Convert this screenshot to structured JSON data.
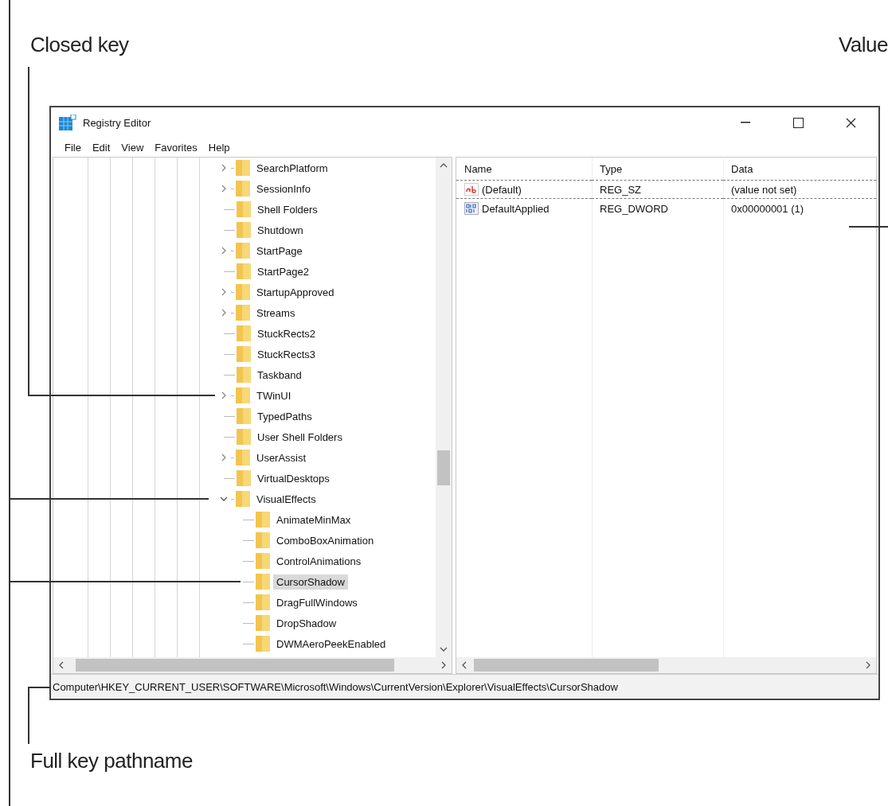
{
  "callouts": [
    {
      "text": "Closed key"
    },
    {
      "text": "Value"
    },
    {
      "text": "Full key pathname"
    }
  ],
  "window": {
    "title": "Registry Editor"
  },
  "menu": [
    "File",
    "Edit",
    "View",
    "Favorites",
    "Help"
  ],
  "tree": {
    "items": [
      {
        "label": "SearchPlatform",
        "expandable": true,
        "expanded": false,
        "selected": false
      },
      {
        "label": "SessionInfo",
        "expandable": true,
        "expanded": false,
        "selected": false
      },
      {
        "label": "Shell Folders",
        "expandable": false,
        "expanded": false,
        "selected": false
      },
      {
        "label": "Shutdown",
        "expandable": false,
        "expanded": false,
        "selected": false
      },
      {
        "label": "StartPage",
        "expandable": true,
        "expanded": false,
        "selected": false
      },
      {
        "label": "StartPage2",
        "expandable": false,
        "expanded": false,
        "selected": false
      },
      {
        "label": "StartupApproved",
        "expandable": true,
        "expanded": false,
        "selected": false
      },
      {
        "label": "Streams",
        "expandable": true,
        "expanded": false,
        "selected": false
      },
      {
        "label": "StuckRects2",
        "expandable": false,
        "expanded": false,
        "selected": false
      },
      {
        "label": "StuckRects3",
        "expandable": false,
        "expanded": false,
        "selected": false
      },
      {
        "label": "Taskband",
        "expandable": false,
        "expanded": false,
        "selected": false
      },
      {
        "label": "TWinUI",
        "expandable": true,
        "expanded": false,
        "selected": false
      },
      {
        "label": "TypedPaths",
        "expandable": false,
        "expanded": false,
        "selected": false
      },
      {
        "label": "User Shell Folders",
        "expandable": false,
        "expanded": false,
        "selected": false
      },
      {
        "label": "UserAssist",
        "expandable": true,
        "expanded": false,
        "selected": false
      },
      {
        "label": "VirtualDesktops",
        "expandable": false,
        "expanded": false,
        "selected": false
      },
      {
        "label": "VisualEffects",
        "expandable": true,
        "expanded": true,
        "selected": false,
        "children": [
          {
            "label": "AnimateMinMax",
            "expandable": false,
            "expanded": false,
            "selected": false
          },
          {
            "label": "ComboBoxAnimation",
            "expandable": false,
            "expanded": false,
            "selected": false
          },
          {
            "label": "ControlAnimations",
            "expandable": false,
            "expanded": false,
            "selected": false
          },
          {
            "label": "CursorShadow",
            "expandable": false,
            "expanded": false,
            "selected": true
          },
          {
            "label": "DragFullWindows",
            "expandable": false,
            "expanded": false,
            "selected": false
          },
          {
            "label": "DropShadow",
            "expandable": false,
            "expanded": false,
            "selected": false
          },
          {
            "label": "DWMAeroPeekEnabled",
            "expandable": false,
            "expanded": false,
            "selected": false
          }
        ]
      }
    ]
  },
  "values": {
    "columns": [
      "Name",
      "Type",
      "Data"
    ],
    "rows": [
      {
        "kind": "string",
        "name": "(Default)",
        "type": "REG_SZ",
        "data": "(value not set)",
        "selected": true
      },
      {
        "kind": "binary",
        "name": "DefaultApplied",
        "type": "REG_DWORD",
        "data": "0x00000001 (1)",
        "selected": false
      }
    ]
  },
  "status_bar": "Computer\\HKEY_CURRENT_USER\\SOFTWARE\\Microsoft\\Windows\\CurrentVersion\\Explorer\\VisualEffects\\CursorShadow"
}
